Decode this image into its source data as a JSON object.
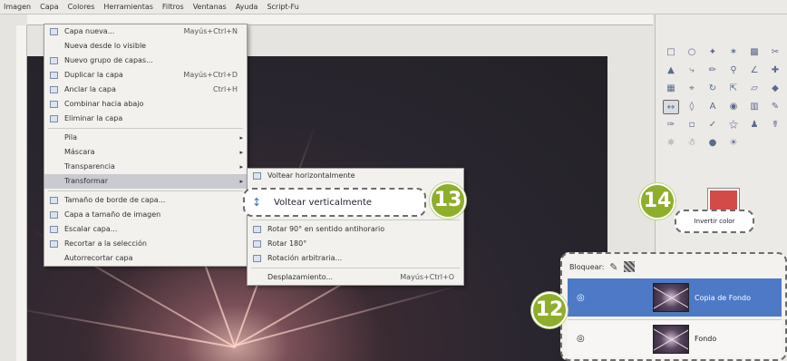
{
  "menubar": {
    "items": [
      "Imagen",
      "Capa",
      "Colores",
      "Herramientas",
      "Filtros",
      "Ventanas",
      "Ayuda",
      "Script-Fu"
    ]
  },
  "main_menu": {
    "items": [
      {
        "label": "Capa nueva...",
        "shortcut": "Mayús+Ctrl+N",
        "icon": "new-layer-icon"
      },
      {
        "label": "Nueva desde lo visible",
        "shortcut": "",
        "icon": ""
      },
      {
        "label": "Nuevo grupo de capas...",
        "shortcut": "",
        "icon": ""
      },
      {
        "label": "Duplicar la capa",
        "shortcut": "Mayús+Ctrl+D",
        "icon": "duplicate-icon"
      },
      {
        "label": "Anclar la capa",
        "shortcut": "Ctrl+H",
        "icon": "anchor-icon"
      },
      {
        "label": "Combinar hacia abajo",
        "shortcut": "",
        "icon": "merge-icon"
      },
      {
        "label": "Eliminar la capa",
        "shortcut": "",
        "icon": "delete-icon"
      }
    ],
    "submenus": [
      "Pila",
      "Máscara",
      "Transparencia",
      "Transformar"
    ],
    "bottom_items": [
      {
        "label": "Tamaño de borde de capa...",
        "icon": "resize-icon"
      },
      {
        "label": "Capa a tamaño de imagen",
        "icon": "fit-icon"
      },
      {
        "label": "Escalar capa...",
        "icon": "scale-icon"
      },
      {
        "label": "Recortar a la selección",
        "icon": "crop-icon"
      },
      {
        "label": "Autorrecortar capa",
        "icon": ""
      }
    ]
  },
  "sub_menu": {
    "items": [
      {
        "label": "Voltear horizontalmente",
        "shortcut": ""
      },
      {
        "label": "Rotar 90° en sentido antihorario",
        "shortcut": ""
      },
      {
        "label": "Rotar 180°",
        "shortcut": ""
      },
      {
        "label": "Rotación arbitraria...",
        "shortcut": ""
      },
      {
        "label": "Desplazamiento...",
        "shortcut": "Mayús+Ctrl+O"
      }
    ]
  },
  "callouts": {
    "flip_vertical": "Voltear verticalmente",
    "tooltip_14": "Invertir color"
  },
  "badges": {
    "b12": "12",
    "b13": "13",
    "b14": "14"
  },
  "layers": {
    "lock_label": "Bloquear:",
    "rows": [
      {
        "name": "Copia de Fondo",
        "selected": true
      },
      {
        "name": "Fondo",
        "selected": false
      }
    ]
  },
  "colors": {
    "accent_badge": "#8fae2b",
    "selected_layer": "#4d79c7",
    "foreground": "#d24b49"
  }
}
